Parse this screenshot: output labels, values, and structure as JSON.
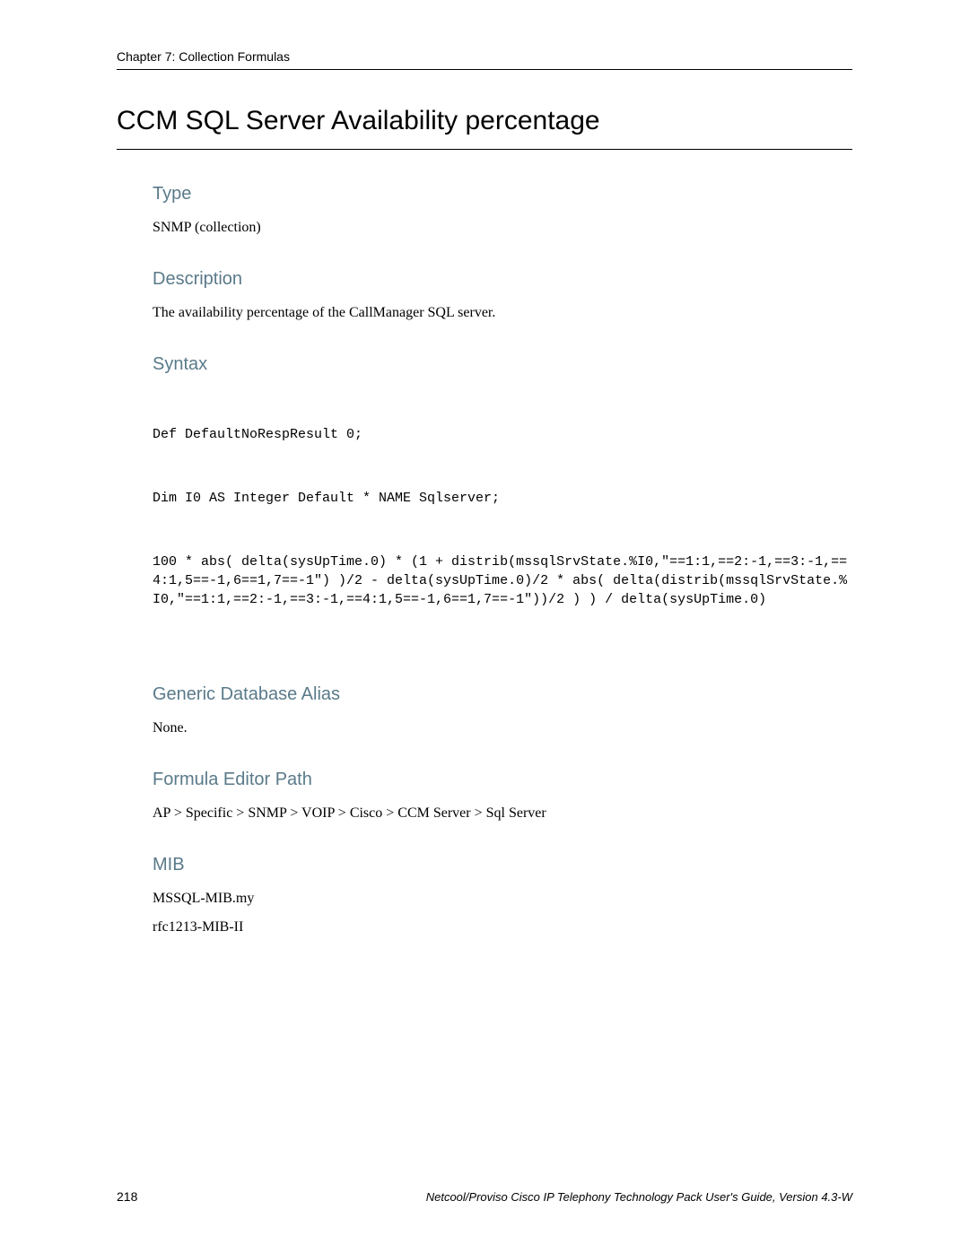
{
  "header": {
    "chapter": "Chapter 7: Collection Formulas"
  },
  "title": "CCM SQL Server Availability percentage",
  "sections": {
    "type": {
      "heading": "Type",
      "body": "SNMP (collection)"
    },
    "description": {
      "heading": "Description",
      "body": "The availability percentage of the CallManager SQL server."
    },
    "syntax": {
      "heading": "Syntax",
      "line1": "Def DefaultNoRespResult 0;",
      "line2": "Dim I0 AS Integer Default * NAME Sqlserver;",
      "line3": "100 * abs( delta(sysUpTime.0) * (1 + distrib(mssqlSrvState.%I0,\"==1:1,==2:-1,==3:-1,==4:1,5==-1,6==1,7==-1\") )/2 - delta(sysUpTime.0)/2 * abs( delta(distrib(mssqlSrvState.%I0,\"==1:1,==2:-1,==3:-1,==4:1,5==-1,6==1,7==-1\"))/2 ) ) / delta(sysUpTime.0)"
    },
    "alias": {
      "heading": "Generic Database Alias",
      "body": "None."
    },
    "path": {
      "heading": "Formula Editor Path",
      "body": "AP > Specific > SNMP > VOIP > Cisco > CCM Server > Sql Server"
    },
    "mib": {
      "heading": "MIB",
      "line1": "MSSQL-MIB.my",
      "line2": "rfc1213-MIB-II"
    }
  },
  "footer": {
    "pageNumber": "218",
    "text": "Netcool/Proviso Cisco IP Telephony Technology Pack User's Guide, Version 4.3-W"
  }
}
